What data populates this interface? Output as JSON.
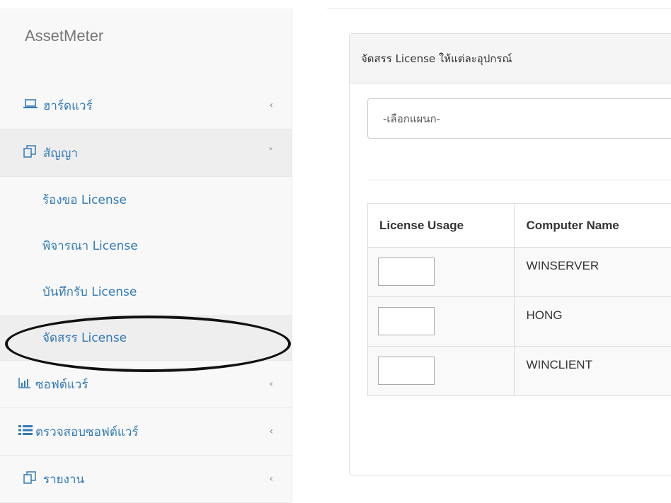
{
  "app": {
    "brand": "AssetMeter"
  },
  "sidebar": {
    "items": [
      {
        "label": "ฮาร์ดแวร์",
        "icon": "laptop-icon",
        "expanded": false
      },
      {
        "label": "สัญญา",
        "icon": "copy-icon",
        "expanded": true,
        "children": [
          {
            "label": "ร้องขอ License"
          },
          {
            "label": "พิจารณา License"
          },
          {
            "label": "บันทึกรับ License"
          },
          {
            "label": "จัดสรร License",
            "current": true
          }
        ]
      },
      {
        "label": "ซอฟต์แวร์",
        "icon": "bar-chart-icon",
        "expanded": false
      },
      {
        "label": "ตรวจสอบซอฟต์แวร์",
        "icon": "list-icon",
        "expanded": false
      },
      {
        "label": "รายงาน",
        "icon": "copy-icon",
        "expanded": false
      }
    ]
  },
  "panel": {
    "heading": "จัดสรร License ให้แต่ละอุปกรณ์",
    "department_select": {
      "selected": "-เลือกแผนก-"
    },
    "table": {
      "headers": [
        "License Usage",
        "Computer Name"
      ],
      "rows": [
        {
          "usage": "",
          "computer": "WINSERVER"
        },
        {
          "usage": "",
          "computer": "HONG"
        },
        {
          "usage": "",
          "computer": "WINCLIENT"
        }
      ]
    }
  },
  "colors": {
    "link": "#337ab7",
    "sidebar_bg": "#f8f8f8",
    "active_bg": "#eeeeee"
  }
}
